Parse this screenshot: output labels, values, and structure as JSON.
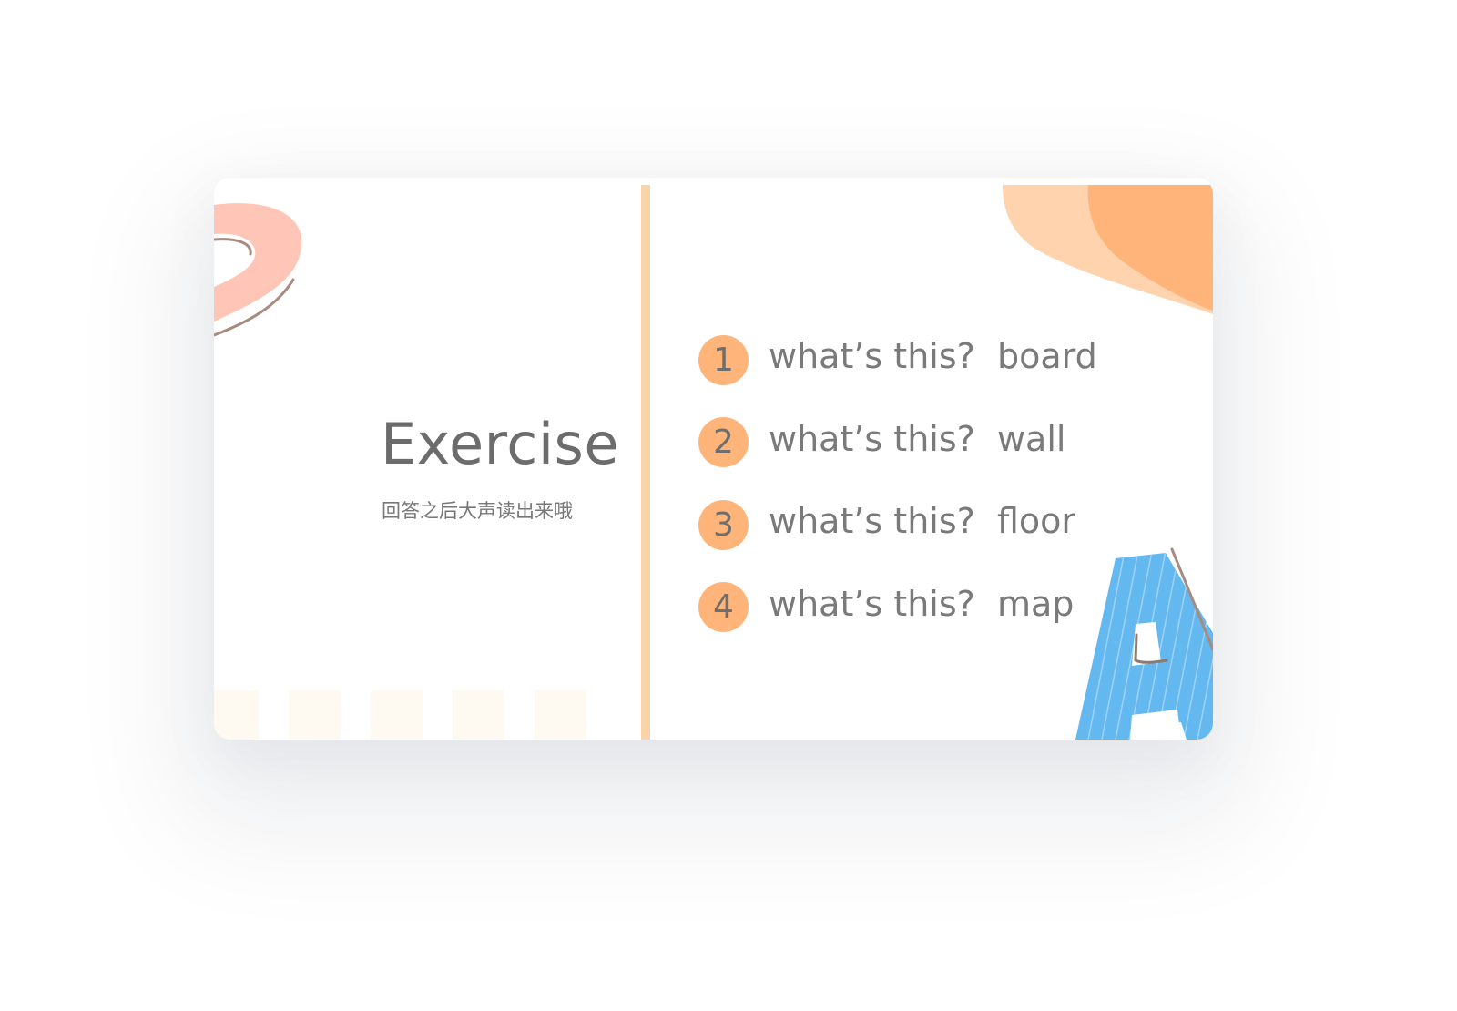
{
  "slide": {
    "title": "Exercise",
    "subtitle": "回答之后大声读出来哦",
    "questions": [
      {
        "number": "1",
        "text": "what’s this?  board"
      },
      {
        "number": "2",
        "text": "what’s this?  wall"
      },
      {
        "number": "3",
        "text": "what’s this?  floor"
      },
      {
        "number": "4",
        "text": "what’s this?  map"
      }
    ],
    "decor_letter": "A"
  },
  "colors": {
    "accent_orange": "#ffb57a",
    "accent_light_orange": "#ffd3ad",
    "divider": "#fbd3a7",
    "pink_ring": "#ffc6b7",
    "letter_blue": "#63b8f0",
    "text_gray": "#6c6c6c"
  }
}
